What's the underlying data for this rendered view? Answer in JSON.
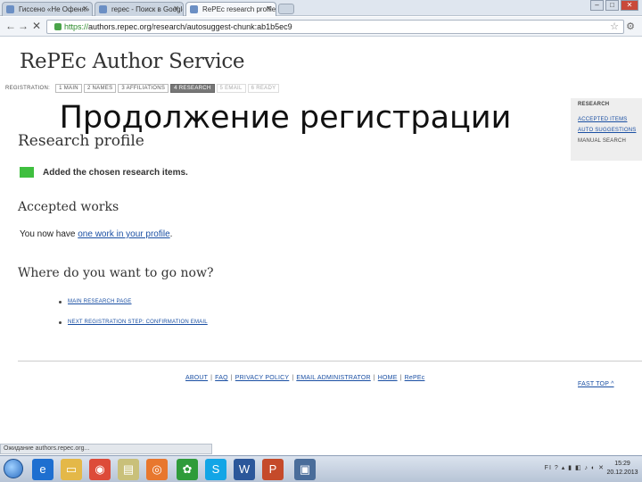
{
  "browser": {
    "tabs": [
      {
        "label": "Гиссено «Не Офеня» про"
      },
      {
        "label": "repec - Поиск в Google"
      },
      {
        "label": "RePEc research profile"
      }
    ],
    "address": {
      "scheme": "https://",
      "rest": "authors.repec.org/research/autosuggest-chunk:ab1b5ec9"
    },
    "status": "Ожидание authors.repec.org..."
  },
  "page": {
    "site_title": "RePEc Author Service",
    "registration": {
      "label": "REGISTRATION:",
      "steps": [
        "1 MAIN",
        "2 NAMES",
        "3 AFFILIATIONS",
        "4 RESEARCH",
        "5 EMAIL",
        "6 READY"
      ]
    },
    "overlay_title": "Продолжение регистрации",
    "sidebar": {
      "heading": "RESEARCH",
      "items": [
        "ACCEPTED ITEMS",
        "AUTO SUGGESTIONS",
        "MANUAL SEARCH"
      ]
    },
    "research_profile": {
      "title": "Research profile",
      "message": "Added the chosen research items."
    },
    "accepted": {
      "title": "Accepted works",
      "prefix": "You now have ",
      "link": "one work in your profile",
      "suffix": "."
    },
    "go": {
      "title": "Where do you want to go now?",
      "links": [
        "MAIN RESEARCH PAGE",
        "NEXT REGISTRATION STEP: CONFIRMATION EMAIL"
      ]
    },
    "footer": {
      "links": [
        "ABOUT",
        "FAQ",
        "PRIVACY POLICY",
        "EMAIL ADMINISTRATOR",
        "HOME",
        "RePEc"
      ],
      "fast_top": "FAST TOP ^"
    }
  },
  "taskbar": {
    "lang": "FI",
    "time": "15:29",
    "date": "20.12.2013"
  }
}
